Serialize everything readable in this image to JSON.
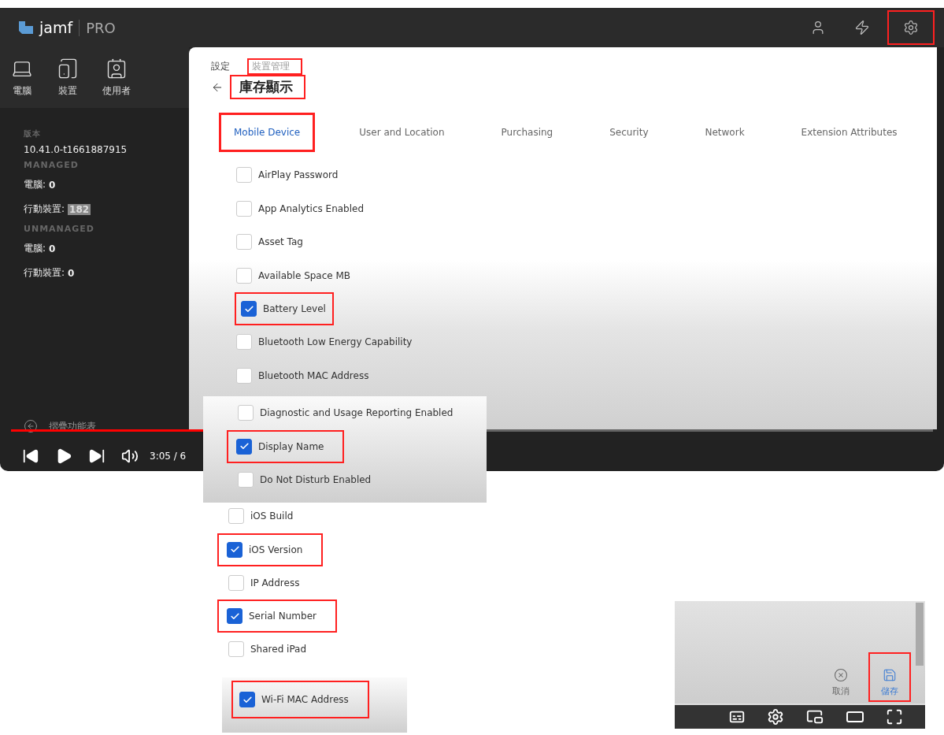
{
  "app": {
    "logo": "jamf",
    "product": "PRO"
  },
  "header_icons": [
    {
      "kind": "user",
      "highlighted": false
    },
    {
      "kind": "bolt",
      "highlighted": false
    },
    {
      "kind": "gear",
      "highlighted": true
    }
  ],
  "sidebar": {
    "nav": [
      {
        "label": "電腦",
        "kind": "laptop"
      },
      {
        "label": "裝置",
        "kind": "tablet"
      },
      {
        "label": "使用者",
        "kind": "user"
      }
    ],
    "version_label": "版本",
    "version": "10.41.0-t1661887915",
    "sections": [
      {
        "title": "MANAGED",
        "rows": [
          {
            "label": "電腦:",
            "value": "0",
            "badge": false
          },
          {
            "label": "行動裝置:",
            "value": "182",
            "badge": true
          }
        ]
      },
      {
        "title": "UNMANAGED",
        "rows": [
          {
            "label": "電腦:",
            "value": "0",
            "badge": false
          },
          {
            "label": "行動裝置:",
            "value": "0",
            "badge": false
          }
        ]
      }
    ],
    "collapse": "摺疊功能表"
  },
  "breadcrumb": [
    {
      "label": "設定",
      "highlighted": false
    },
    {
      "label": "裝置管理",
      "highlighted": true
    }
  ],
  "title": {
    "text": "庫存顯示",
    "highlighted": true
  },
  "tabs": [
    {
      "label": "Mobile Device",
      "selected": true,
      "highlighted": true
    },
    {
      "label": "User and Location",
      "selected": false,
      "highlighted": false
    },
    {
      "label": "Purchasing",
      "selected": false,
      "highlighted": false
    },
    {
      "label": "Security",
      "selected": false,
      "highlighted": false
    },
    {
      "label": "Network",
      "selected": false,
      "highlighted": false
    },
    {
      "label": "Extension Attributes",
      "selected": false,
      "highlighted": false
    }
  ],
  "fields": [
    {
      "label": "AirPlay Password",
      "checked": false,
      "highlighted": false
    },
    {
      "label": "App Analytics Enabled",
      "checked": false,
      "highlighted": false
    },
    {
      "label": "Asset Tag",
      "checked": false,
      "highlighted": false
    },
    {
      "label": "Available Space MB",
      "checked": false,
      "highlighted": false
    },
    {
      "label": "Battery Level",
      "checked": true,
      "highlighted": true
    },
    {
      "label": "Bluetooth Low Energy Capability",
      "checked": false,
      "highlighted": false
    },
    {
      "label": "Bluetooth MAC Address",
      "checked": false,
      "highlighted": false
    }
  ],
  "player": {
    "time": "3:05 / 6",
    "level": 0.3
  },
  "overlay_fields": [
    {
      "label": "Diagnostic and Usage Reporting Enabled",
      "checked": false,
      "highlighted": false
    },
    {
      "label": "Display Name",
      "checked": true,
      "highlighted": true
    },
    {
      "label": "Do Not Disturb Enabled",
      "checked": false,
      "highlighted": false
    }
  ],
  "lower_fields": [
    {
      "label": "iOS Build",
      "checked": false,
      "highlighted": false
    },
    {
      "label": "iOS Version",
      "checked": true,
      "highlighted": true
    },
    {
      "label": "IP Address",
      "checked": false,
      "highlighted": false
    },
    {
      "label": "Serial Number",
      "checked": true,
      "highlighted": true
    },
    {
      "label": "Shared iPad",
      "checked": false,
      "highlighted": false
    }
  ],
  "bottom_fields": [
    {
      "label": "Wi-Fi MAC Address",
      "checked": true,
      "highlighted": true
    }
  ],
  "actions": [
    {
      "label": "取消",
      "kind": "cancel",
      "highlighted": false
    },
    {
      "label": "儲存",
      "kind": "save",
      "highlighted": true
    }
  ]
}
